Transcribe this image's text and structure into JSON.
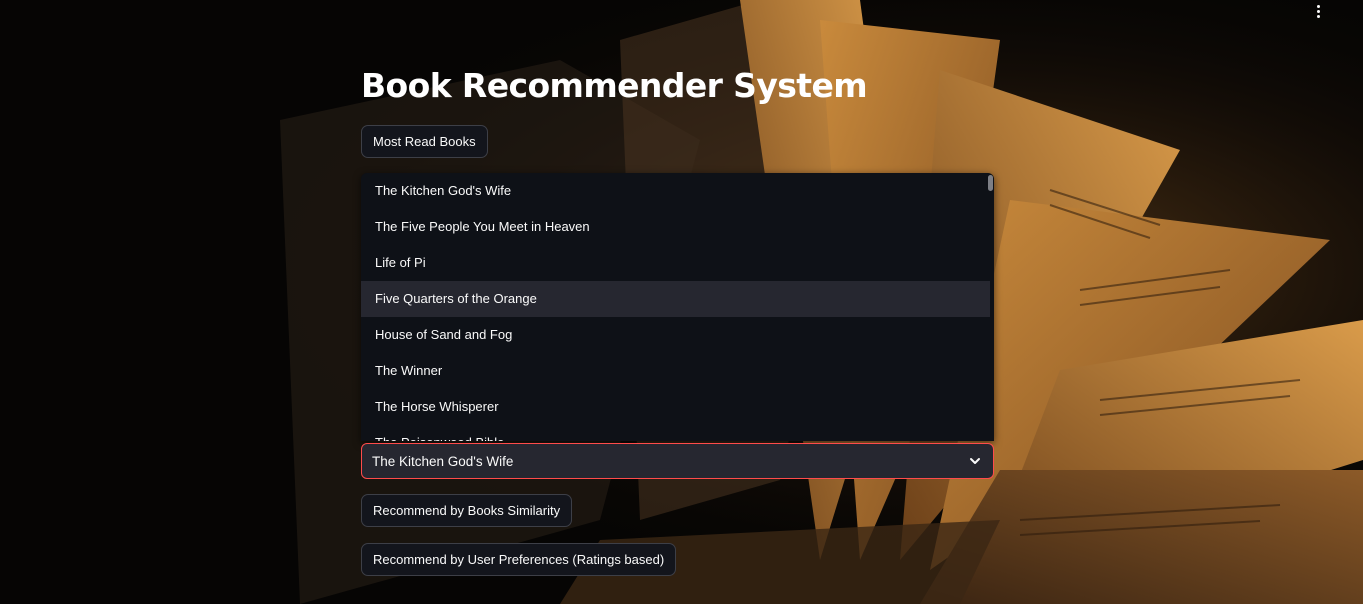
{
  "app": {
    "title": "Book Recommender System"
  },
  "buttons": {
    "most_read": "Most Read Books",
    "by_similarity": "Recommend by Books Similarity",
    "by_preferences": "Recommend by User Preferences (Ratings based)"
  },
  "select": {
    "selected_value": "The Kitchen God's Wife",
    "options": [
      "The Kitchen God's Wife",
      "The Five People You Meet in Heaven",
      "Life of Pi",
      "Five Quarters of the Orange",
      "House of Sand and Fog",
      "The Winner",
      "The Horse Whisperer",
      "The Poisonwood Bible"
    ],
    "highlighted_option": "Five Quarters of the Orange"
  },
  "icons": {
    "main_menu": "vertical-dots-icon",
    "select_caret": "chevron-down-icon"
  },
  "colors": {
    "accent": "#ff4b4b",
    "panel": "#0e1117",
    "button_bg": "#13151c",
    "select_bg": "#262730"
  }
}
